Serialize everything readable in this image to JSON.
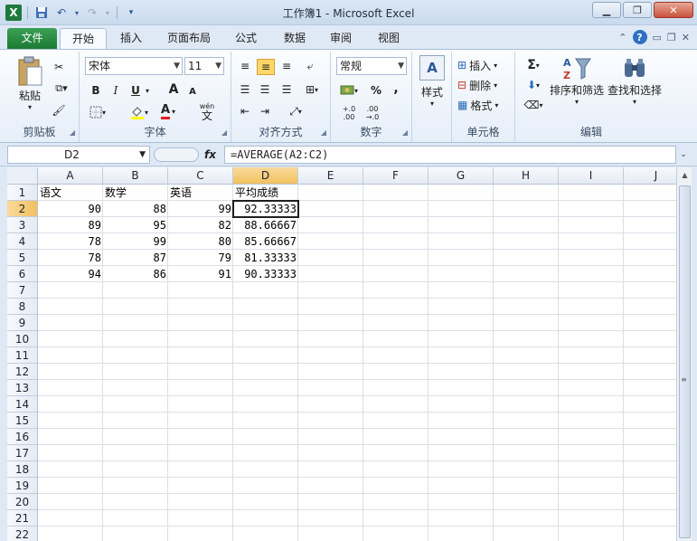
{
  "window": {
    "title": "工作簿1  -  Microsoft Excel",
    "min_icon": "minimize-icon",
    "max_icon": "restore-icon",
    "close_icon": "close-icon"
  },
  "qat": {
    "logo": "X",
    "save_icon": "save-icon",
    "undo_icon": "undo-icon",
    "redo_icon": "redo-icon",
    "more_icon": "customize-qat-icon"
  },
  "tabs": {
    "file": "文件",
    "home": "开始",
    "insert": "插入",
    "layout": "页面布局",
    "formulas": "公式",
    "data": "数据",
    "review": "审阅",
    "view": "视图"
  },
  "ribbon": {
    "clipboard": {
      "label": "剪贴板",
      "paste": "粘贴"
    },
    "font": {
      "label": "字体",
      "name": "宋体",
      "size": "11",
      "bold": "B",
      "italic": "I",
      "underline": "U",
      "grow": "A",
      "shrink": "A",
      "fontcolor": "A",
      "phonetic": "wén",
      "phonetic_char": "文"
    },
    "alignment": {
      "label": "对齐方式"
    },
    "number": {
      "label": "数字",
      "format": "常规",
      "percent": "%",
      "comma": ",",
      "inc": "+.0 .00",
      "dec": ".00 →.0"
    },
    "styles": {
      "label": "样式"
    },
    "cells": {
      "label": "单元格",
      "insert": "插入",
      "delete": "删除",
      "format": "格式"
    },
    "editing": {
      "label": "编辑",
      "sort": "排序和筛选",
      "find": "查找和选择",
      "sum": "Σ"
    }
  },
  "formula_bar": {
    "name_box": "D2",
    "fx": "fx",
    "formula": "=AVERAGE(A2:C2)"
  },
  "accent": {
    "file_tab": "#1d7a33",
    "selection_header": "#f1c15f"
  },
  "columns": [
    "A",
    "B",
    "C",
    "D",
    "E",
    "F",
    "G",
    "H",
    "I",
    "J"
  ],
  "rows": [
    "1",
    "2",
    "3",
    "4",
    "5",
    "6",
    "7",
    "8",
    "9",
    "10",
    "11",
    "12",
    "13",
    "14",
    "15",
    "16",
    "17",
    "18",
    "19",
    "20",
    "21",
    "22"
  ],
  "cells": {
    "A1": "语文",
    "B1": "数学",
    "C1": "英语",
    "D1": "平均成绩",
    "A2": "90",
    "B2": "88",
    "C2": "99",
    "D2": "92.33333",
    "A3": "89",
    "B3": "95",
    "C3": "82",
    "D3": "88.66667",
    "A4": "78",
    "B4": "99",
    "C4": "80",
    "D4": "85.66667",
    "A5": "78",
    "B5": "87",
    "C5": "79",
    "D5": "81.33333",
    "A6": "94",
    "B6": "86",
    "C6": "91",
    "D6": "90.33333"
  }
}
